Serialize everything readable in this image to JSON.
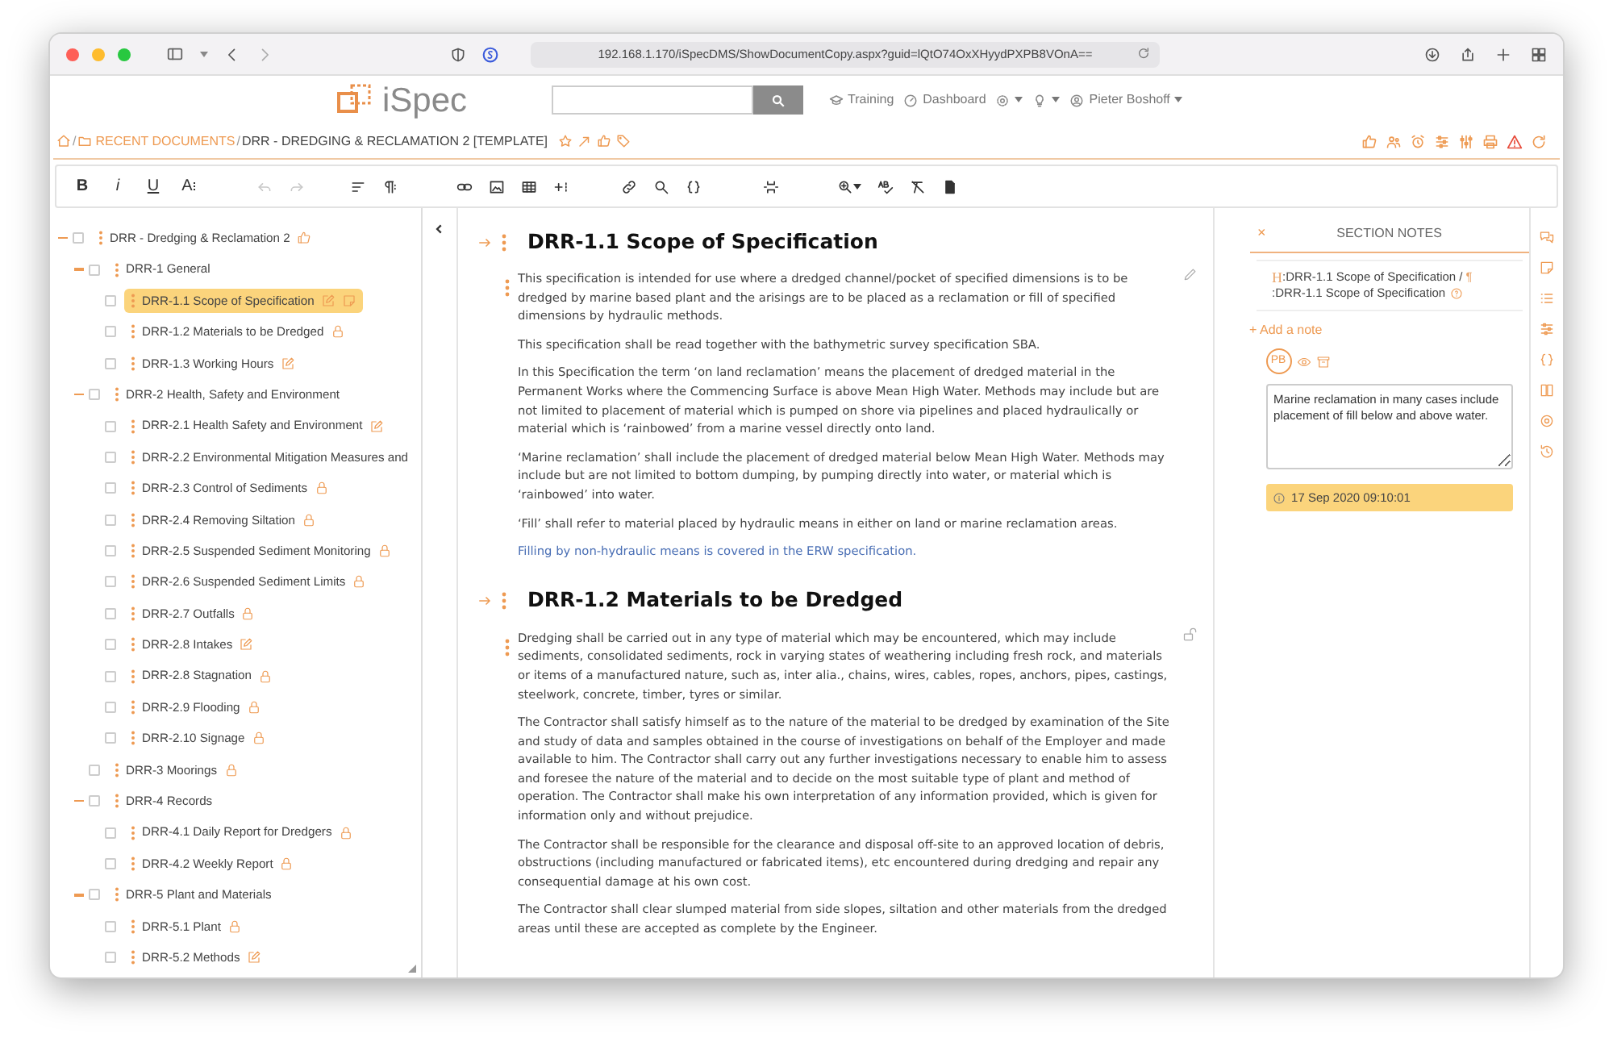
{
  "browser": {
    "url": "192.168.1.170/iSpecDMS/ShowDocumentCopy.aspx?guid=lQtO74OxXHyydPXPB8VOnA=="
  },
  "header": {
    "logo": "iSpec",
    "nav": [
      {
        "kind": "training",
        "label": "Training"
      },
      {
        "kind": "dashboard",
        "label": "Dashboard"
      },
      {
        "kind": "settings",
        "dropdown": true
      },
      {
        "kind": "help",
        "dropdown": true
      },
      {
        "kind": "user",
        "label": "Pieter Boshoff",
        "dropdown": true
      }
    ]
  },
  "breadcrumb": {
    "segments": [
      {
        "kind": "home"
      },
      {
        "kind": "separator",
        "label": "/"
      },
      {
        "kind": "folder",
        "label": "RECENT DOCUMENTS"
      },
      {
        "kind": "separator",
        "label": "/"
      },
      {
        "kind": "current",
        "label": "DRR - DREDGING & RECLAMATION 2 [TEMPLATE]"
      }
    ],
    "actions": [
      {
        "kind": "favorite"
      },
      {
        "kind": "share"
      },
      {
        "kind": "like"
      },
      {
        "kind": "tag"
      }
    ],
    "tools": [
      {
        "kind": "like"
      },
      {
        "kind": "users"
      },
      {
        "kind": "alarm"
      },
      {
        "kind": "sliders"
      },
      {
        "kind": "filters"
      },
      {
        "kind": "print"
      },
      {
        "kind": "warning"
      },
      {
        "kind": "refresh"
      }
    ]
  },
  "toolbar": [
    {
      "kind": "bold",
      "label": "B"
    },
    {
      "kind": "italic",
      "label": "i"
    },
    {
      "kind": "underline",
      "label": "U"
    },
    {
      "kind": "font-size",
      "label": "A"
    },
    {
      "kind": "undo",
      "disabled": true
    },
    {
      "kind": "redo",
      "disabled": true
    },
    {
      "kind": "align",
      "disabled": false
    },
    {
      "kind": "paragraph",
      "disabled": false
    },
    {
      "kind": "link",
      "disabled": false
    },
    {
      "kind": "image",
      "disabled": false
    },
    {
      "kind": "table",
      "disabled": false
    },
    {
      "kind": "insert",
      "disabled": false
    },
    {
      "kind": "hyperlink",
      "disabled": false
    },
    {
      "kind": "search",
      "disabled": false
    },
    {
      "kind": "code",
      "disabled": false
    },
    {
      "kind": "page-break",
      "disabled": false
    },
    {
      "kind": "zoom",
      "disabled": false
    },
    {
      "kind": "spellcheck",
      "disabled": false
    },
    {
      "kind": "clear-format",
      "disabled": false
    },
    {
      "kind": "document",
      "disabled": false
    }
  ],
  "tree": [
    {
      "label": "DRR - Dredging & Reclamation 2",
      "badges": [
        {
          "kind": "like"
        }
      ],
      "expanded": true,
      "checked": false,
      "selected": false,
      "children": [
        {
          "label": "DRR-1 General",
          "expanded": true,
          "checked": false,
          "selected": false,
          "children": [
            {
              "label": "DRR-1.1 Scope of Specification",
              "badges": [
                {
                  "kind": "edit"
                },
                {
                  "kind": "note"
                }
              ],
              "checked": false,
              "selected": true
            },
            {
              "label": "DRR-1.2 Materials to be Dredged",
              "badges": [
                {
                  "kind": "lock"
                }
              ],
              "checked": false,
              "selected": false
            },
            {
              "label": "DRR-1.3 Working Hours",
              "badges": [
                {
                  "kind": "edit"
                }
              ],
              "checked": false,
              "selected": false
            }
          ]
        },
        {
          "label": "DRR-2 Health, Safety and Environment",
          "expanded": true,
          "checked": false,
          "selected": false,
          "children": [
            {
              "label": "DRR-2.1 Health Safety and Environment",
              "badges": [
                {
                  "kind": "edit"
                }
              ],
              "checked": false,
              "selected": false
            },
            {
              "label": "DRR-2.2 Environmental Mitigation Measures and",
              "checked": false,
              "selected": false
            },
            {
              "label": "DRR-2.3 Control of Sediments",
              "badges": [
                {
                  "kind": "lock"
                }
              ],
              "checked": false,
              "selected": false
            },
            {
              "label": "DRR-2.4 Removing Siltation",
              "badges": [
                {
                  "kind": "lock"
                }
              ],
              "checked": false,
              "selected": false
            },
            {
              "label": "DRR-2.5 Suspended Sediment Monitoring",
              "badges": [
                {
                  "kind": "lock"
                }
              ],
              "checked": false,
              "selected": false
            },
            {
              "label": "DRR-2.6 Suspended Sediment Limits",
              "badges": [
                {
                  "kind": "lock"
                }
              ],
              "checked": false,
              "selected": false
            },
            {
              "label": "DRR-2.7 Outfalls",
              "badges": [
                {
                  "kind": "lock"
                }
              ],
              "checked": false,
              "selected": false
            },
            {
              "label": "DRR-2.8 Intakes",
              "badges": [
                {
                  "kind": "edit"
                }
              ],
              "checked": false,
              "selected": false
            },
            {
              "label": "DRR-2.8 Stagnation",
              "badges": [
                {
                  "kind": "lock"
                }
              ],
              "checked": false,
              "selected": false
            },
            {
              "label": "DRR-2.9 Flooding",
              "badges": [
                {
                  "kind": "lock"
                }
              ],
              "checked": false,
              "selected": false
            },
            {
              "label": "DRR-2.10 Signage",
              "badges": [
                {
                  "kind": "lock"
                }
              ],
              "checked": false,
              "selected": false
            }
          ]
        },
        {
          "label": "DRR-3 Moorings",
          "badges": [
            {
              "kind": "lock"
            }
          ],
          "checked": false,
          "selected": false
        },
        {
          "label": "DRR-4 Records",
          "expanded": true,
          "checked": false,
          "selected": false,
          "children": [
            {
              "label": "DRR-4.1 Daily Report for Dredgers",
              "badges": [
                {
                  "kind": "lock"
                }
              ],
              "checked": false,
              "selected": false
            },
            {
              "label": "DRR-4.2 Weekly Report",
              "badges": [
                {
                  "kind": "lock"
                }
              ],
              "checked": false,
              "selected": false
            }
          ]
        },
        {
          "label": "DRR-5 Plant and Materials",
          "expanded": true,
          "checked": false,
          "selected": false,
          "children": [
            {
              "label": "DRR-5.1 Plant",
              "badges": [
                {
                  "kind": "lock"
                }
              ],
              "checked": false,
              "selected": false
            },
            {
              "label": "DRR-5.2 Methods",
              "badges": [
                {
                  "kind": "edit"
                }
              ],
              "checked": false,
              "selected": false
            }
          ]
        }
      ]
    }
  ],
  "sections": [
    {
      "heading": "DRR-1.1 Scope of Specification",
      "kind": "editable",
      "paragraphs": [
        {
          "kind": "text",
          "text": "This specification is intended for use where a dredged channel/pocket of specified dimensions is to be dredged by marine based plant and the arisings are to be placed as a reclamation or fill of specified dimensions by hydraulic methods."
        },
        {
          "kind": "text",
          "text": "This specification shall be read together with the bathymetric survey specification SBA."
        },
        {
          "kind": "text",
          "text": "In this Specification the term ‘on land reclamation’ means the placement of dredged material in the Permanent Works where the Commencing Surface is above Mean High Water. Methods may include but are not limited to placement of material which is pumped on shore via pipelines and placed hydraulically or material which is ‘rainbowed’ from a marine vessel directly onto land."
        },
        {
          "kind": "text",
          "text": "‘Marine reclamation’ shall include the placement of dredged material below Mean High Water. Methods may include but are not limited to bottom dumping, by pumping directly into water, or material which is ‘rainbowed’ into water."
        },
        {
          "kind": "text",
          "text": "‘Fill’ shall refer to material placed by hydraulic means in either on land or marine reclamation areas."
        },
        {
          "kind": "link",
          "text": "Filling by non-hydraulic means is covered in the ERW specification."
        }
      ]
    },
    {
      "heading": "DRR-1.2 Materials to be Dredged",
      "kind": "unlocked",
      "paragraphs": [
        {
          "kind": "text",
          "text": "Dredging shall be carried out in any type of material which may be encountered, which may include sediments, consolidated sediments, rock in varying states of weathering including fresh rock, and materials or items of a manufactured nature, such as, inter alia., chains, wires, cables, ropes, anchors, pipes, castings, steelwork, concrete, timber, tyres or similar."
        },
        {
          "kind": "text",
          "text": "The Contractor shall satisfy himself as to the nature of the material to be dredged by examination of the Site and study of data and samples obtained in the course of investigations on behalf of the Employer and made available to him. The Contractor shall carry out any further investigations necessary to enable him to assess and foresee the nature of the material and to decide on the most suitable type of plant and method of operation. The Contractor shall make his own interpretation of any information provided, which is given for information only and without prejudice."
        },
        {
          "kind": "text",
          "text": "The Contractor shall be responsible for the clearance and disposal off-site to an approved location of debris, obstructions (including manufactured or fabricated items), etc encountered during dredging and repair any consequential damage at his own cost."
        },
        {
          "kind": "text",
          "text": "The Contractor shall clear slumped material from side slopes, siltation and other materials from the dredged areas until these are accepted as complete by the Engineer."
        }
      ]
    }
  ],
  "notes": {
    "close": "×",
    "title": "SECTION NOTES",
    "reference": {
      "heading_marker": "H",
      "heading": ":DRR-1.1 Scope of Specification /",
      "paragraph_marker": "¶",
      "paragraph": ":DRR-1.1 Scope of Specification"
    },
    "add": "+ Add a note",
    "items": [
      {
        "initials": "PB",
        "text": "Marine reclamation in many cases include placement of fill below and above water.",
        "timestamp": "17 Sep 2020 09:10:01"
      }
    ],
    "side_icons": [
      {
        "kind": "comments"
      },
      {
        "kind": "note"
      },
      {
        "kind": "list"
      },
      {
        "kind": "sliders"
      },
      {
        "kind": "code"
      },
      {
        "kind": "book"
      },
      {
        "kind": "circle"
      },
      {
        "kind": "history"
      }
    ]
  }
}
